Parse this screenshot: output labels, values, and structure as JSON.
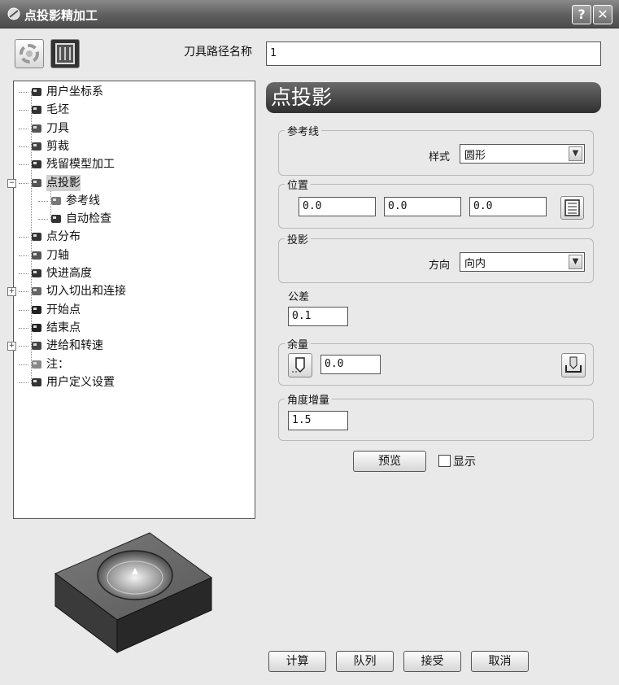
{
  "window": {
    "title": "点投影精加工",
    "help": "?",
    "close": "✕"
  },
  "toolpath_name": {
    "label": "刀具路径名称",
    "value": "1"
  },
  "tree": [
    {
      "label": "用户坐标系",
      "icon": "ucs-icon"
    },
    {
      "label": "毛坯",
      "icon": "block-icon"
    },
    {
      "label": "刀具",
      "icon": "tool-icon"
    },
    {
      "label": "剪裁",
      "icon": "trim-icon"
    },
    {
      "label": "残留模型加工",
      "icon": "rest-model-icon"
    },
    {
      "label": "点投影",
      "icon": "point-projection-icon",
      "expander": "−",
      "selected": true
    },
    {
      "label": "参考线",
      "icon": "reference-line-icon"
    },
    {
      "label": "自动检查",
      "icon": "auto-verify-icon"
    },
    {
      "label": "点分布",
      "icon": "point-distribution-icon"
    },
    {
      "label": "刀轴",
      "icon": "tool-axis-icon"
    },
    {
      "label": "快进高度",
      "icon": "rapid-height-icon"
    },
    {
      "label": "切入切出和连接",
      "icon": "leads-links-icon",
      "expander": "+"
    },
    {
      "label": "开始点",
      "icon": "start-point-icon"
    },
    {
      "label": "结束点",
      "icon": "end-point-icon"
    },
    {
      "label": "进给和转速",
      "icon": "feeds-speeds-icon",
      "expander": "+"
    },
    {
      "label": "注：",
      "icon": "notes-icon"
    },
    {
      "label": "用户定义设置",
      "icon": "user-settings-icon"
    }
  ],
  "panel": {
    "title": "点投影",
    "reference_line": {
      "group": "参考线",
      "style_label": "样式",
      "style_value": "圆形"
    },
    "position": {
      "group": "位置",
      "x": "0.0",
      "y": "0.0",
      "z": "0.0"
    },
    "projection": {
      "group": "投影",
      "direction_label": "方向",
      "direction_value": "向内"
    },
    "tolerance": {
      "label": "公差",
      "value": "0.1"
    },
    "thickness": {
      "group": "余量",
      "value": "0.0"
    },
    "angular_increment": {
      "group": "角度增量",
      "value": "1.5"
    },
    "preview_button": "预览",
    "show_label": "显示"
  },
  "buttons": {
    "calculate": "计算",
    "queue": "队列",
    "accept": "接受",
    "cancel": "取消"
  }
}
